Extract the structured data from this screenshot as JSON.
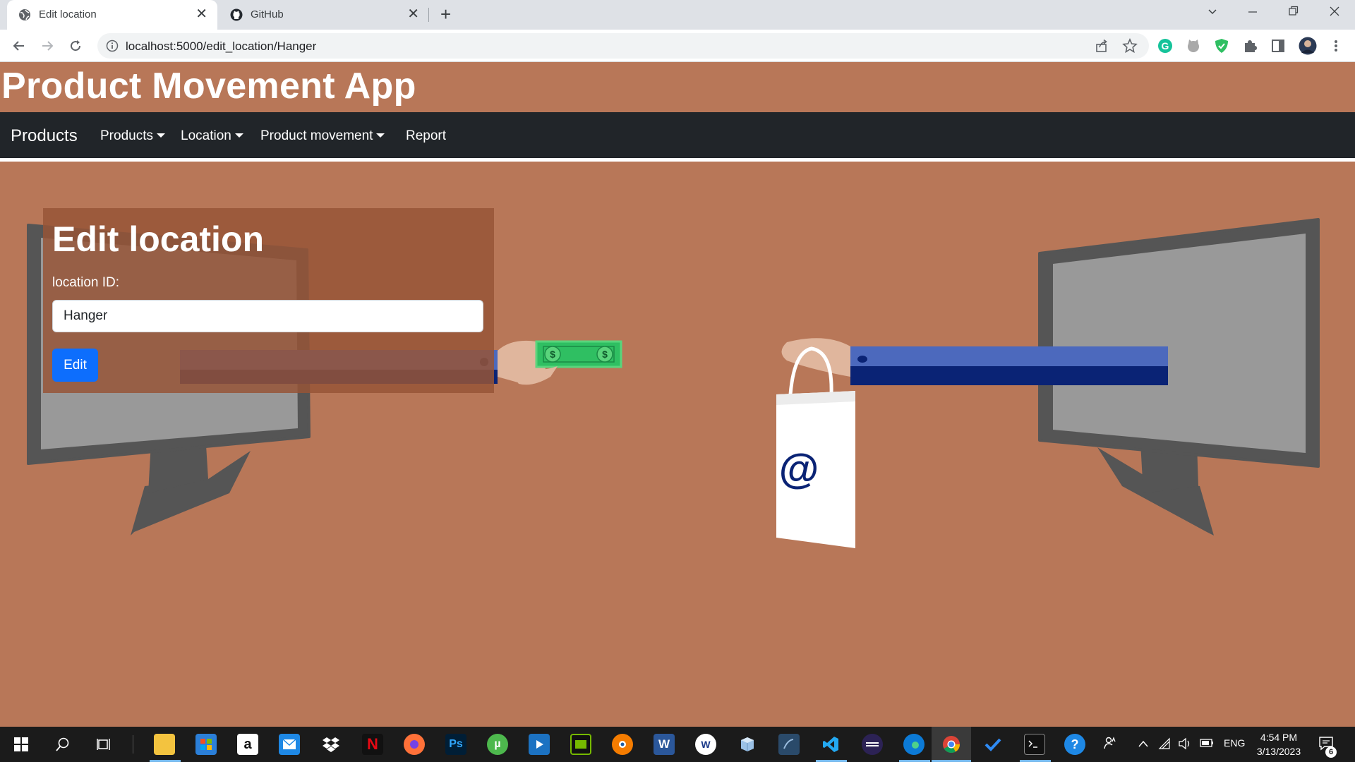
{
  "browser": {
    "tabs": [
      {
        "title": "Edit location",
        "active": true
      },
      {
        "title": "GitHub",
        "active": false
      }
    ],
    "new_tab": "+",
    "url": "localhost:5000/edit_location/Hanger"
  },
  "app": {
    "title": "Product Movement App",
    "brand": "Products",
    "nav": [
      {
        "label": "Products",
        "dropdown": true
      },
      {
        "label": "Location",
        "dropdown": true
      },
      {
        "label": "Product movement",
        "dropdown": true
      },
      {
        "label": "Report",
        "dropdown": false
      }
    ]
  },
  "form": {
    "heading": "Edit location",
    "label": "location ID:",
    "value": "Hanger",
    "button": "Edit"
  },
  "illustration": {
    "money_symbol": "$",
    "bag_symbol": "@"
  },
  "taskbar": {
    "apps": [
      "windows-start",
      "search",
      "task-view",
      "file-explorer",
      "microsoft-store",
      "amazon",
      "mail",
      "dropbox",
      "netflix",
      "firefox",
      "photoshop",
      "utorrent",
      "media-player",
      "nvidia",
      "blender",
      "word",
      "app-w",
      "virtualbox",
      "mysql-workbench",
      "vscode",
      "eclipse",
      "edge",
      "chrome",
      "todo",
      "terminal",
      "help"
    ],
    "language": "ENG",
    "time": "4:54 PM",
    "date": "3/13/2023",
    "notifications": "6"
  },
  "colors": {
    "page_bg": "#b87758",
    "navbar_bg": "#212529",
    "card_bg": "#9a5a3e",
    "button": "#0d6efd"
  }
}
